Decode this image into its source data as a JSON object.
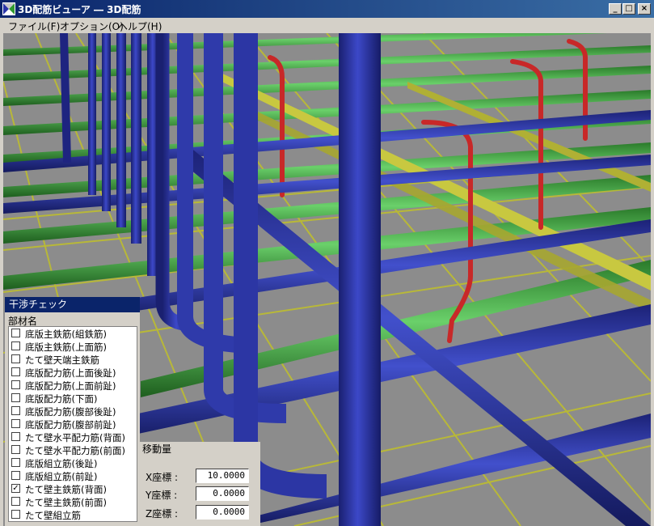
{
  "window": {
    "title": "3D配筋ビューア ― 3D配筋",
    "minimize": "_",
    "maximize": "□",
    "close": "×"
  },
  "menu": [
    {
      "label": "ファイル(F)"
    },
    {
      "label": "オプション(O)"
    },
    {
      "label": "ヘルプ(H)"
    }
  ],
  "interference_panel": {
    "title": "干渉チェック",
    "column_header": "部材名",
    "items": [
      {
        "label": "底版主鉄筋(組鉄筋)",
        "checked": false
      },
      {
        "label": "底版主鉄筋(上面筋)",
        "checked": false
      },
      {
        "label": "たて壁天端主鉄筋",
        "checked": false
      },
      {
        "label": "底版配力筋(上面後趾)",
        "checked": false
      },
      {
        "label": "底版配力筋(上面前趾)",
        "checked": false
      },
      {
        "label": "底版配力筋(下面)",
        "checked": false
      },
      {
        "label": "底版配力筋(腹部後趾)",
        "checked": false
      },
      {
        "label": "底版配力筋(腹部前趾)",
        "checked": false
      },
      {
        "label": "たて壁水平配力筋(背面)",
        "checked": false
      },
      {
        "label": "たて壁水平配力筋(前面)",
        "checked": false
      },
      {
        "label": "底版組立筋(後趾)",
        "checked": false
      },
      {
        "label": "底版組立筋(前趾)",
        "checked": false
      },
      {
        "label": "たて壁主鉄筋(背面)",
        "checked": true
      },
      {
        "label": "たて壁主鉄筋(前面)",
        "checked": false
      },
      {
        "label": "たて壁組立筋",
        "checked": false
      }
    ]
  },
  "move_panel": {
    "title": "移動量",
    "x_label": "X座標 :",
    "x_value": "10.0000",
    "y_label": "Y座標 :",
    "y_value": "0.0000",
    "z_label": "Z座標 :",
    "z_value": "0.0000"
  },
  "colors": {
    "background": "#8c8c8c",
    "blue_rebar": "#2a34a8",
    "green_rebar": "#2f9a2f",
    "yellow_rebar": "#b8b838",
    "red_rebar": "#c82828",
    "title_bar": "#0a246a"
  }
}
